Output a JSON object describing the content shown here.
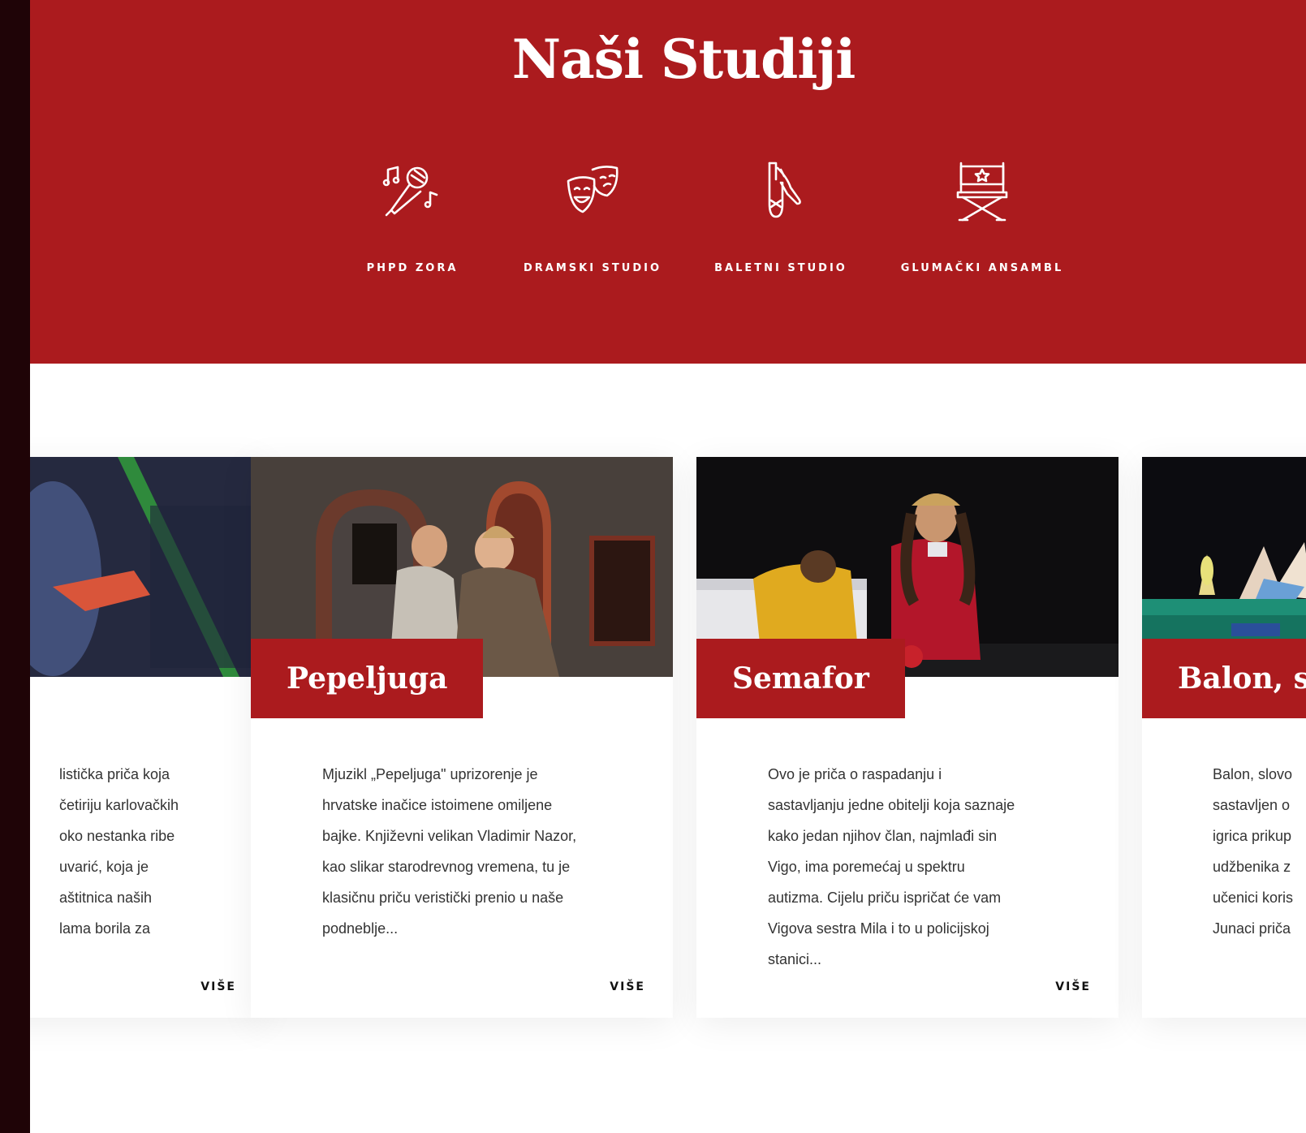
{
  "hero": {
    "title": "Naši Studiji",
    "background_color": "#ab1b1e",
    "studios": [
      {
        "icon": "microphone-music-icon",
        "label": "PHPD ZORA"
      },
      {
        "icon": "theater-masks-icon",
        "label": "DRAMSKI STUDIO"
      },
      {
        "icon": "ballet-shoes-icon",
        "label": "BALETNI STUDIO"
      },
      {
        "icon": "director-chair-icon",
        "label": "GLUMAČKI ANSAMBL"
      }
    ]
  },
  "cards": [
    {
      "title": "",
      "lines": [
        "listička priča koja",
        "četiriju karlovačkih",
        "oko nestanka ribe",
        "uvarić, koja je",
        "aštitnica naših",
        "lama borila za"
      ],
      "more": "VIŠE"
    },
    {
      "title": "Pepeljuga",
      "lines": [
        "Mjuzikl „Pepeljuga\" uprizorenje je",
        "hrvatske inačice istoimene omiljene",
        "bajke. Književni velikan Vladimir Nazor,",
        "kao slikar starodrevnog vremena, tu je",
        "klasičnu priču veristički prenio u naše",
        "podneblje..."
      ],
      "more": "VIŠE"
    },
    {
      "title": "Semafor",
      "lines": [
        "Ovo je priča o raspadanju i",
        "sastavljanju jedne obitelji koja saznaje",
        "kako jedan njihov član, najmlađi sin",
        "Vigo, ima poremećaj u spektru",
        "autizma. Cijelu priču ispričat će vam",
        "Vigova sestra Mila i to u policijskoj",
        "stanici..."
      ],
      "more": "VIŠE"
    },
    {
      "title": "Balon, slo",
      "lines": [
        "Balon, slovo",
        "sastavljen o",
        "igrica prikup",
        "udžbenika z",
        "učenici koris",
        "Junaci priča"
      ],
      "more": ""
    }
  ]
}
